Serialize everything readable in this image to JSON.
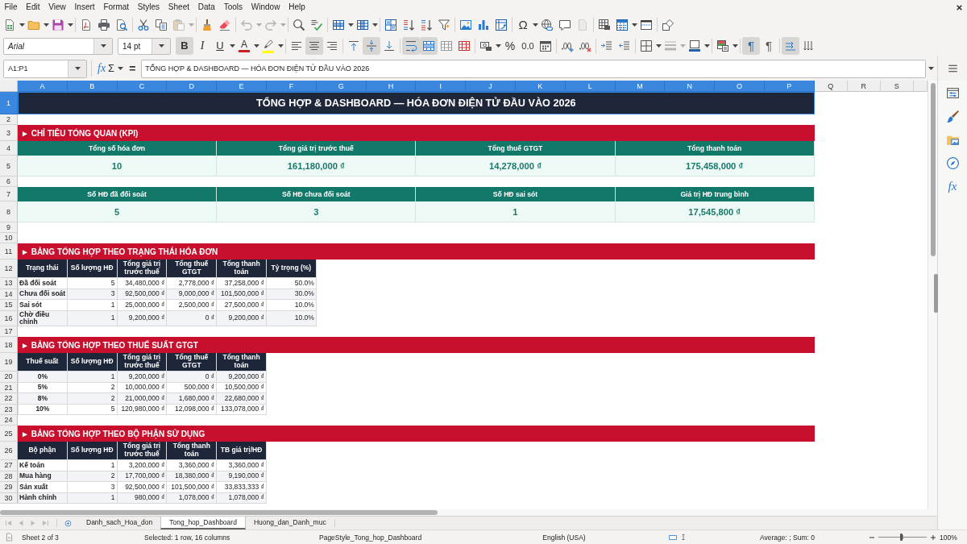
{
  "menu_bar": {
    "items": [
      "File",
      "Edit",
      "View",
      "Insert",
      "Format",
      "Styles",
      "Sheet",
      "Data",
      "Tools",
      "Window",
      "Help"
    ]
  },
  "standard_toolbar": [
    [
      {
        "kind": "new",
        "dropdown": true,
        "disabled": false
      },
      {
        "kind": "open",
        "dropdown": true,
        "disabled": false
      },
      {
        "kind": "save",
        "dropdown": true,
        "disabled": false
      }
    ],
    [
      {
        "kind": "export_pdf",
        "disabled": false
      },
      {
        "kind": "print",
        "disabled": false
      },
      {
        "kind": "print_preview",
        "disabled": false
      }
    ],
    [
      {
        "kind": "cut",
        "disabled": false
      },
      {
        "kind": "copy",
        "disabled": false
      },
      {
        "kind": "paste",
        "dropdown": true,
        "disabled": true
      }
    ],
    [
      {
        "kind": "clone",
        "disabled": false
      },
      {
        "kind": "clear",
        "disabled": false
      }
    ],
    [
      {
        "kind": "undo",
        "dropdown": true,
        "disabled": true
      },
      {
        "kind": "redo",
        "dropdown": true,
        "disabled": true
      }
    ],
    [
      {
        "kind": "find",
        "disabled": false
      },
      {
        "kind": "spelling",
        "disabled": false
      }
    ],
    [
      {
        "kind": "rows",
        "dropdown": true,
        "disabled": false
      },
      {
        "kind": "columns",
        "dropdown": true,
        "disabled": false
      }
    ],
    [
      {
        "kind": "sort",
        "disabled": false
      },
      {
        "kind": "sort_asc",
        "disabled": false
      },
      {
        "kind": "sort_desc",
        "disabled": false
      },
      {
        "kind": "autofilter",
        "disabled": false
      }
    ],
    [
      {
        "kind": "image",
        "disabled": false
      },
      {
        "kind": "chart",
        "disabled": false
      },
      {
        "kind": "pivot",
        "disabled": false
      }
    ],
    [
      {
        "kind": "special_char",
        "label": "Ω",
        "dropdown": true,
        "disabled": false
      },
      {
        "kind": "hyperlink",
        "disabled": false
      },
      {
        "kind": "comment",
        "disabled": false
      },
      {
        "kind": "page",
        "disabled": true
      }
    ],
    [
      {
        "kind": "headers",
        "disabled": false
      },
      {
        "kind": "print_range",
        "dropdown": true,
        "disabled": false
      },
      {
        "kind": "freeze",
        "disabled": false
      }
    ],
    [
      {
        "kind": "shapes",
        "disabled": false
      }
    ]
  ],
  "formatting_toolbar": {
    "font_name": "Arial",
    "font_size": "14 pt",
    "groups": [
      [
        {
          "kind": "bold",
          "label": "B",
          "pressed": true,
          "disabled": false
        },
        {
          "kind": "italic",
          "label": "I",
          "pressed": false,
          "disabled": false
        },
        {
          "kind": "underline",
          "label": "U",
          "dropdown": true,
          "pressed": false,
          "disabled": false
        },
        {
          "kind": "font_color",
          "label": "A",
          "color": "#c9211e",
          "dropdown": true,
          "pressed": false,
          "disabled": false
        },
        {
          "kind": "highlight",
          "color": "#ffff00",
          "dropdown": true,
          "pressed": false,
          "disabled": false
        }
      ],
      [
        {
          "kind": "align_left",
          "pressed": false,
          "disabled": false
        },
        {
          "kind": "align_center",
          "pressed": true,
          "disabled": false
        },
        {
          "kind": "align_right",
          "pressed": false,
          "disabled": false
        }
      ],
      [
        {
          "kind": "align_top",
          "pressed": false,
          "disabled": false
        },
        {
          "kind": "align_middle",
          "pressed": true,
          "disabled": false
        },
        {
          "kind": "align_bottom",
          "pressed": false,
          "disabled": false
        }
      ],
      [
        {
          "kind": "wrap",
          "pressed": true,
          "disabled": false
        },
        {
          "kind": "merge_center",
          "pressed": true,
          "disabled": false
        },
        {
          "kind": "unmerge",
          "pressed": false,
          "disabled": false
        },
        {
          "kind": "merge",
          "pressed": false,
          "disabled": false
        }
      ],
      [
        {
          "kind": "currency",
          "dropdown": true,
          "pressed": false,
          "disabled": false
        },
        {
          "kind": "percent",
          "label": "%",
          "pressed": false,
          "disabled": false
        },
        {
          "kind": "number",
          "label": "0.0",
          "pressed": false,
          "disabled": false
        },
        {
          "kind": "date",
          "pressed": false,
          "disabled": false
        }
      ],
      [
        {
          "kind": "add_decimal",
          "pressed": false,
          "disabled": false
        },
        {
          "kind": "delete_decimal",
          "pressed": false,
          "disabled": false
        }
      ],
      [
        {
          "kind": "indent_more",
          "pressed": false,
          "disabled": false
        },
        {
          "kind": "indent_less",
          "pressed": false,
          "disabled": false
        }
      ],
      [
        {
          "kind": "borders",
          "dropdown": true,
          "pressed": false,
          "disabled": false
        },
        {
          "kind": "border_style",
          "dropdown": true,
          "pressed": false,
          "disabled": true
        },
        {
          "kind": "border_color",
          "dropdown": true,
          "pressed": false,
          "disabled": false
        }
      ],
      [
        {
          "kind": "conditional",
          "dropdown": true,
          "pressed": false,
          "disabled": false
        }
      ],
      [
        {
          "kind": "ltr",
          "label": "¶",
          "pressed": true,
          "disabled": false
        },
        {
          "kind": "rtl",
          "label": "¶",
          "pressed": false,
          "disabled": false
        }
      ],
      [
        {
          "kind": "text_direction",
          "pressed": true,
          "disabled": false
        },
        {
          "kind": "vertical_text",
          "pressed": false,
          "disabled": false
        }
      ]
    ]
  },
  "formula_bar": {
    "name_box": "A1:P1",
    "function_wizard": "fx",
    "sum": "Σ",
    "formula": "=",
    "content": "TỔNG HỢP & DASHBOARD — HÓA ĐƠN ĐIỆN TỬ ĐẦU VÀO 2026"
  },
  "sidebar": {
    "decks": [
      {
        "kind": "properties"
      },
      {
        "kind": "styles"
      },
      {
        "kind": "gallery"
      },
      {
        "kind": "navigator"
      },
      {
        "kind": "functions",
        "label": "fx"
      }
    ]
  },
  "sheet": {
    "columns": [
      {
        "label": "A",
        "selected": true
      },
      {
        "label": "B",
        "selected": true
      },
      {
        "label": "C",
        "selected": true
      },
      {
        "label": "D",
        "selected": true
      },
      {
        "label": "E",
        "selected": true
      },
      {
        "label": "F",
        "selected": true
      },
      {
        "label": "G",
        "selected": true
      },
      {
        "label": "H",
        "selected": true
      },
      {
        "label": "I",
        "selected": true
      },
      {
        "label": "J",
        "selected": true
      },
      {
        "label": "K",
        "selected": true
      },
      {
        "label": "L",
        "selected": true
      },
      {
        "label": "M",
        "selected": true
      },
      {
        "label": "N",
        "selected": true
      },
      {
        "label": "O",
        "selected": true
      },
      {
        "label": "P",
        "selected": true
      },
      {
        "label": "Q",
        "selected": false
      },
      {
        "label": "R",
        "selected": false
      },
      {
        "label": "S",
        "selected": false
      }
    ],
    "rows": [
      {
        "label": "1",
        "selected": true
      },
      {
        "label": "2",
        "selected": false
      },
      {
        "label": "3",
        "selected": false
      },
      {
        "label": "4",
        "selected": false
      },
      {
        "label": "5",
        "selected": false
      },
      {
        "label": "6",
        "selected": false
      },
      {
        "label": "7",
        "selected": false
      },
      {
        "label": "8",
        "selected": false
      },
      {
        "label": "9",
        "selected": false
      },
      {
        "label": "10",
        "selected": false
      },
      {
        "label": "11",
        "selected": false
      },
      {
        "label": "12",
        "selected": false
      },
      {
        "label": "13",
        "selected": false
      },
      {
        "label": "14",
        "selected": false
      },
      {
        "label": "15",
        "selected": false
      },
      {
        "label": "16",
        "selected": false
      },
      {
        "label": "17",
        "selected": false
      },
      {
        "label": "18",
        "selected": false
      },
      {
        "label": "19",
        "selected": false
      },
      {
        "label": "20",
        "selected": false
      },
      {
        "label": "21",
        "selected": false
      },
      {
        "label": "22",
        "selected": false
      },
      {
        "label": "23",
        "selected": false
      },
      {
        "label": "24",
        "selected": false
      },
      {
        "label": "25",
        "selected": false
      },
      {
        "label": "26",
        "selected": false
      },
      {
        "label": "27",
        "selected": false
      },
      {
        "label": "28",
        "selected": false
      },
      {
        "label": "29",
        "selected": false
      },
      {
        "label": "30",
        "selected": false
      }
    ],
    "title": {
      "text": "TỔNG HỢP & DASHBOARD — HÓA ĐƠN ĐIỆN TỬ ĐẦU VÀO 2026",
      "selected": true
    },
    "kpi": {
      "heading": "► CHỈ TIÊU TỔNG QUAN (KPI)",
      "groups": [
        [
          {
            "label": "Tổng số hóa đơn",
            "value": "10"
          },
          {
            "label": "Tổng giá trị trước thuế",
            "value": "161,180,000 ₫"
          },
          {
            "label": "Tổng thuế GTGT",
            "value": "14,278,000 ₫"
          },
          {
            "label": "Tổng thanh toán",
            "value": "175,458,000 ₫"
          }
        ],
        [
          {
            "label": "Số HĐ đã đối soát",
            "value": "5"
          },
          {
            "label": "Số HĐ chưa đối soát",
            "value": "3"
          },
          {
            "label": "Số HĐ sai sót",
            "value": "1"
          },
          {
            "label": "Giá trị HĐ trung bình",
            "value": "17,545,800 ₫"
          }
        ]
      ]
    },
    "tables": [
      {
        "kind": "status",
        "heading": "► BẢNG TỔNG HỢP THEO TRẠNG THÁI HÓA ĐƠN",
        "columns": [
          "Trạng thái",
          "Số lượng HĐ",
          "Tổng giá trị trước thuế",
          "Tổng thuế GTGT",
          "Tổng thanh toán",
          "Tỷ trọng (%)"
        ],
        "rows": [
          [
            "Đã đối soát",
            "5",
            "34,480,000 ₫",
            "2,778,000 ₫",
            "37,258,000 ₫",
            "50.0%"
          ],
          [
            "Chưa đối soát",
            "3",
            "92,500,000 ₫",
            "9,000,000 ₫",
            "101,500,000 ₫",
            "30.0%"
          ],
          [
            "Sai sót",
            "1",
            "25,000,000 ₫",
            "2,500,000 ₫",
            "27,500,000 ₫",
            "10.0%"
          ],
          [
            "Chờ điều chỉnh",
            "1",
            "9,200,000 ₫",
            "0 ₫",
            "9,200,000 ₫",
            "10.0%"
          ]
        ]
      },
      {
        "kind": "vat_rate",
        "heading": "► BẢNG TỔNG HỢP THEO THUẾ SUẤT GTGT",
        "columns": [
          "Thuế suất",
          "Số lượng HĐ",
          "Tổng giá trị trước thuế",
          "Tổng thuế GTGT",
          "Tổng thanh toán"
        ],
        "rows": [
          [
            "0%",
            "1",
            "9,200,000 ₫",
            "0 ₫",
            "9,200,000 ₫"
          ],
          [
            "5%",
            "2",
            "10,000,000 ₫",
            "500,000 ₫",
            "10,500,000 ₫"
          ],
          [
            "8%",
            "2",
            "21,000,000 ₫",
            "1,680,000 ₫",
            "22,680,000 ₫"
          ],
          [
            "10%",
            "5",
            "120,980,000 ₫",
            "12,098,000 ₫",
            "133,078,000 ₫"
          ]
        ]
      },
      {
        "kind": "department",
        "heading": "► BẢNG TỔNG HỢP THEO BỘ PHẬN SỬ DỤNG",
        "columns": [
          "Bộ phận",
          "Số lượng HĐ",
          "Tổng giá trị trước thuế",
          "Tổng thanh toán",
          "TB giá trị/HĐ"
        ],
        "rows": [
          [
            "Kế toán",
            "1",
            "3,200,000 ₫",
            "3,360,000 ₫",
            "3,360,000 ₫"
          ],
          [
            "Mua hàng",
            "2",
            "17,700,000 ₫",
            "18,380,000 ₫",
            "9,190,000 ₫"
          ],
          [
            "Sản xuất",
            "3",
            "92,500,000 ₫",
            "101,500,000 ₫",
            "33,833,333 ₫"
          ],
          [
            "Hành chính",
            "1",
            "980,000 ₫",
            "1,078,000 ₫",
            "1,078,000 ₫"
          ]
        ]
      }
    ]
  },
  "sheet_tabs": [
    {
      "label": "Danh_sach_Hoa_don",
      "selected": false
    },
    {
      "label": "Tong_hop_Dashboard",
      "selected": true
    },
    {
      "label": "Huong_dan_Danh_muc",
      "selected": false
    }
  ],
  "status_bar": {
    "sheet": "Sheet 2 of 3",
    "selection": "Selected: 1 row, 16 columns",
    "page_style": "PageStyle_Tong_hop_Dashboard",
    "language": "English (USA)",
    "summary": "Average: ; Sum: 0",
    "zoom": {
      "level": 0.47
    },
    "zoom_percent": "100%"
  }
}
